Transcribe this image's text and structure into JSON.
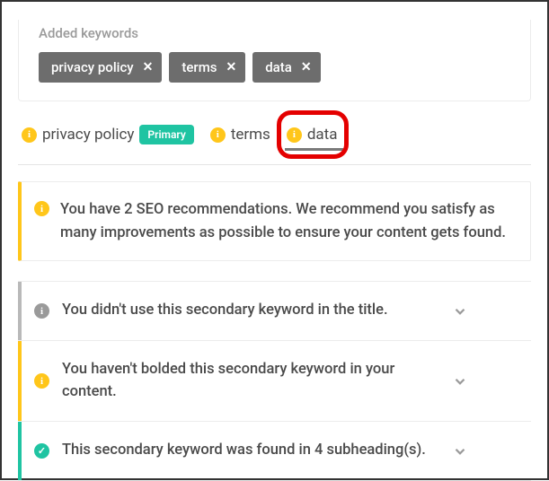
{
  "added_section": {
    "title": "Added keywords",
    "chips": [
      "privacy policy",
      "terms",
      "data"
    ]
  },
  "tabs": {
    "items": [
      {
        "label": "privacy policy",
        "primary": true
      },
      {
        "label": "terms",
        "primary": false
      },
      {
        "label": "data",
        "primary": false,
        "active": true
      }
    ],
    "primary_badge": "Primary"
  },
  "recommendation": {
    "text": "You have 2 SEO recommendations. We recommend you satisfy as many improvements as possible to ensure your content gets found."
  },
  "accordions": [
    {
      "status": "gray",
      "text": "You didn't use this secondary keyword in the title."
    },
    {
      "status": "yellow",
      "text": "You haven't bolded this secondary keyword in your content."
    },
    {
      "status": "green",
      "text": "This secondary keyword was found in 4 subheading(s)."
    }
  ],
  "icons": {
    "info_glyph": "i",
    "check_glyph": "✓",
    "close_glyph": "✕"
  }
}
